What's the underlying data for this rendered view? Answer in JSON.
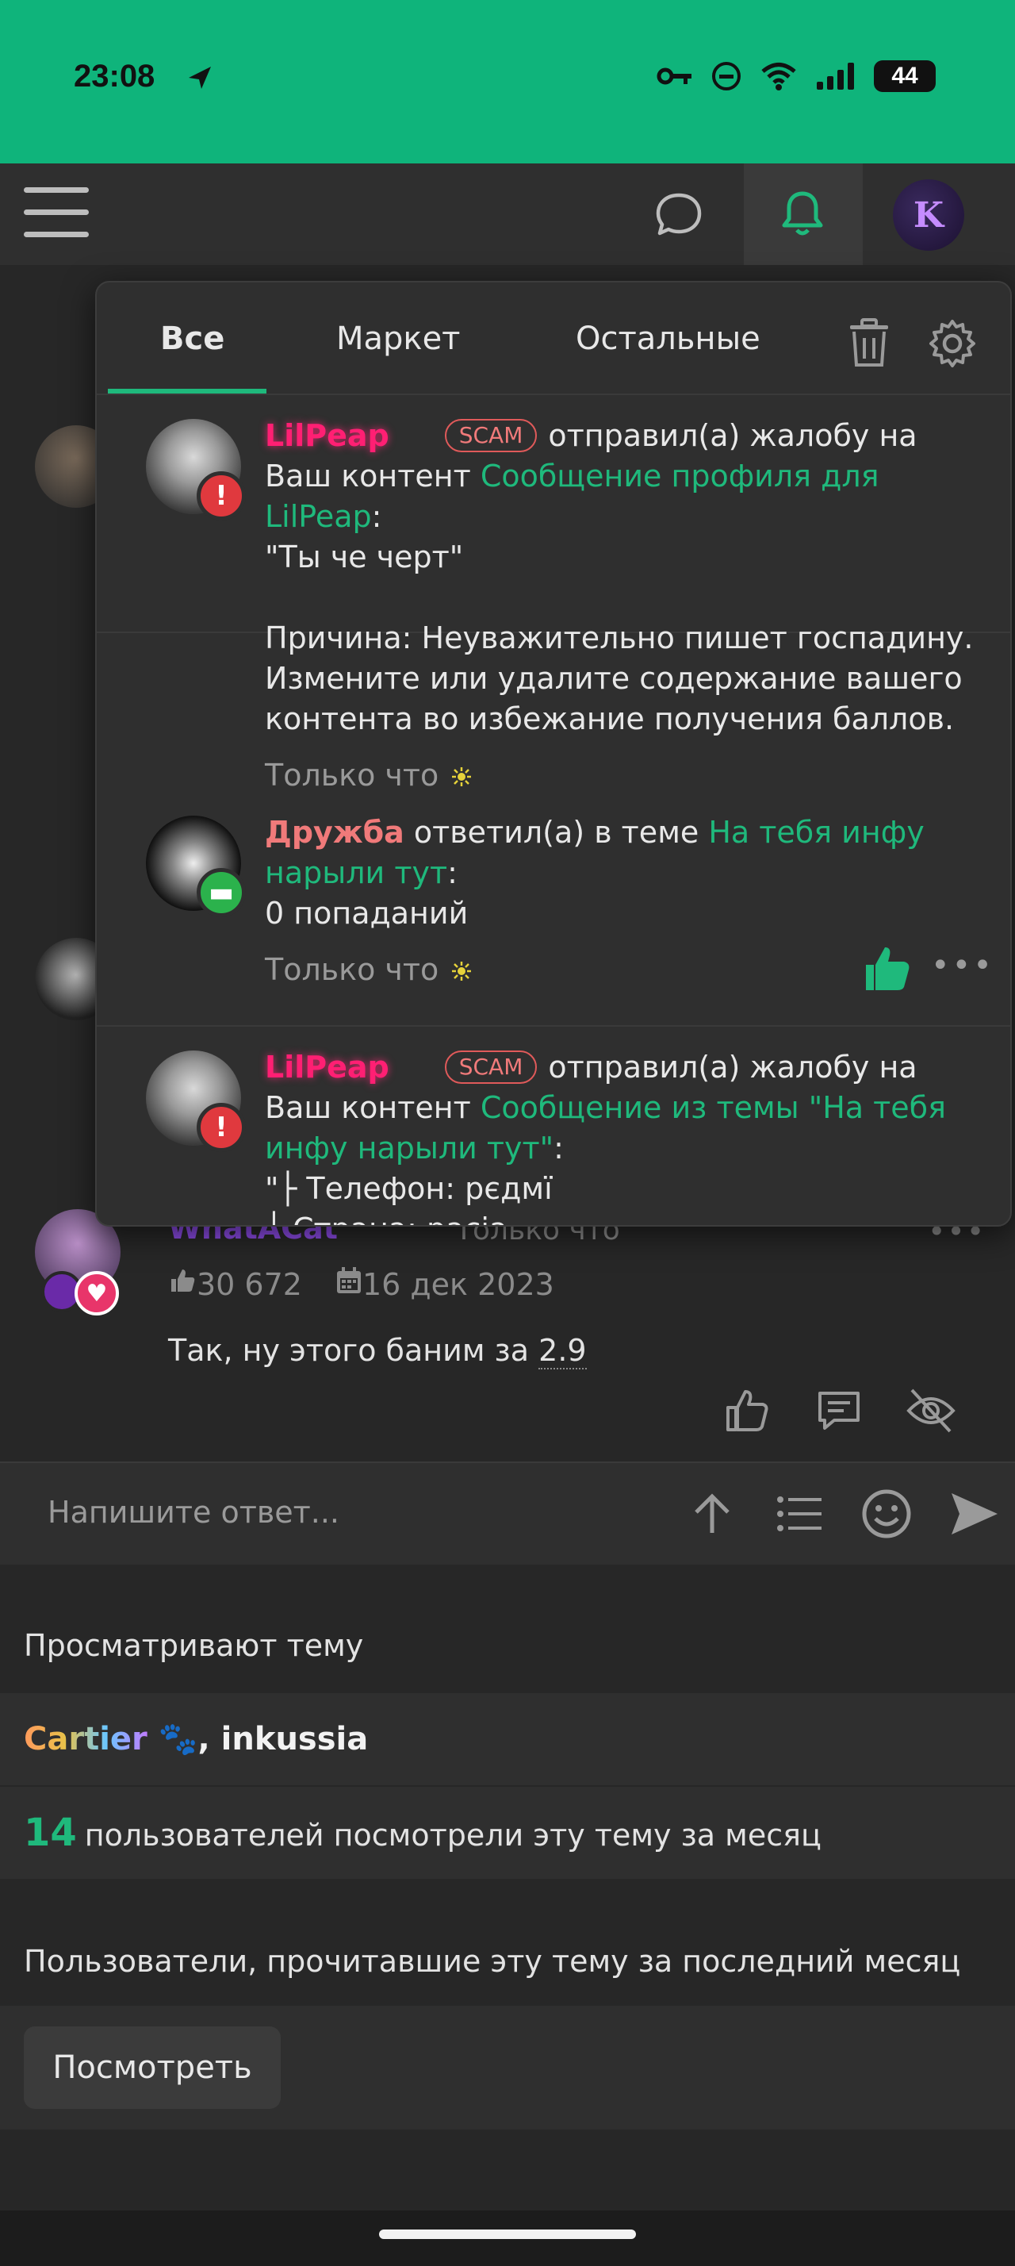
{
  "status_bar": {
    "time": "23:08",
    "battery": "44"
  },
  "popup": {
    "tabs": [
      {
        "label": "Все",
        "active": true
      },
      {
        "label": "Маркет",
        "active": false
      },
      {
        "label": "Остальные",
        "active": false
      }
    ],
    "notifications": [
      {
        "user": "LilPeap",
        "badge": "SCAM",
        "action": "отправил(а) жалобу на Ваш контент",
        "link": "Сообщение профиля для LilPeap",
        "quote": "\"Ты че черт\"",
        "reason_line1": "Причина: Неуважительно пишет госпадину.",
        "reason_line2": "Измените или удалите содержание вашего",
        "reason_line3": "контента во избежание получения баллов.",
        "time": "Только что"
      },
      {
        "user": "Дружба",
        "action": "ответил(а) в теме",
        "link": "На тебя инфу нарыли тут",
        "quote": "0 попаданий",
        "time": "Только что"
      },
      {
        "user": "LilPeap",
        "badge": "SCAM",
        "action": "отправил(а) жалобу на Ваш контент",
        "link": "Сообщение из темы \"На тебя инфу нарыли тут\"",
        "quote_line1": "\"├ Телефон: pєдмї",
        "quote_line2": "├ Страна: pacia"
      }
    ]
  },
  "post": {
    "author": "WhatACat",
    "time": "Только что",
    "likes": "30 672",
    "date": "16 дек 2023",
    "text": "Так, ну этого баним за",
    "value": "2.9"
  },
  "reply": {
    "placeholder": "Напишите ответ..."
  },
  "viewing": {
    "title": "Просматривают тему",
    "user1": "Cartier",
    "separator": ",",
    "user2": "inkussia",
    "count": "14",
    "count_text": "пользователей посмотрели эту тему за месяц"
  },
  "readers": {
    "title": "Пользователи, прочитавшие эту тему за последний месяц",
    "button": "Посмотреть"
  },
  "colors": {
    "accent": "#1fb97c",
    "status_bar": "#0fb47b",
    "background": "#272727",
    "panel": "#2f2f2f",
    "scam": "#f07a7a"
  }
}
